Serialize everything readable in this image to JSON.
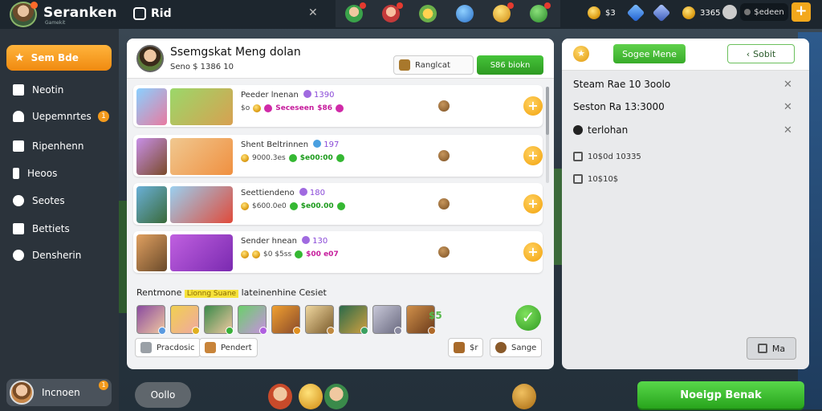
{
  "topbar": {
    "app_title": "Seranken",
    "app_subtitle": "Gamekit",
    "tab_label": "Rid",
    "res1_value": "$3",
    "res2_value": "3365",
    "pill_label": "$edeen",
    "plus_label": "+"
  },
  "sidebar": {
    "primary_label": "Sem Bde",
    "items": [
      {
        "label": "Neotin"
      },
      {
        "label": "Uepemnrtes",
        "badge": "1"
      },
      {
        "label": "Ripenhenn"
      },
      {
        "label": "Heoos"
      },
      {
        "label": "Seotes"
      },
      {
        "label": "Bettiets"
      },
      {
        "label": "Densherin"
      }
    ],
    "user_name": "Incnoen",
    "user_badge": "1"
  },
  "main": {
    "title": "Ssemgskat Meng dolan",
    "subtitle": "Seno $ 1386 10",
    "search_placeholder": "Ranglcat",
    "action_label": "S86 biokn",
    "rows": [
      {
        "title": "Peeder lnenan",
        "level": "1390",
        "meta": "$o",
        "score": "Seceseen",
        "score2": "$86"
      },
      {
        "title": "Shent Beltrinnen",
        "level": "197",
        "meta": "9000.3es",
        "score": "$e00:00"
      },
      {
        "title": "Seettiendeno",
        "level": "180",
        "meta": "$600.0e0",
        "score": "$e00.00"
      },
      {
        "title": "Sender hnean",
        "level": "130",
        "meta": "$0 $5ss",
        "score": "$00 e07"
      }
    ],
    "reward_label": "Rentmone",
    "reward_highlight": "Lionng Suane",
    "reward_tail": "lateinenhine Cesiet",
    "chars_more": "$5",
    "chips": [
      {
        "label": "Pracdosic"
      },
      {
        "label": "Pendert"
      },
      {
        "label": "$r"
      },
      {
        "label": "Sange"
      }
    ]
  },
  "right_panel": {
    "tab_active": "Sogee Mene",
    "tab_inactive": "Sobit",
    "items": [
      {
        "label": "Steam Rae 10 3oolo",
        "closable": true
      },
      {
        "label": "Seston Ra 13:3000",
        "closable": true
      },
      {
        "label": "terlohan",
        "closable": true
      },
      {
        "label": "10$0d 10335",
        "closable": false
      },
      {
        "label": "10$10$",
        "closable": false
      }
    ],
    "button_label": "Ma"
  },
  "bottom": {
    "pill_label": "Oollo",
    "cta_label": "Noeigp Benak"
  },
  "colors": {
    "accent_orange": "#f08a10",
    "accent_green": "#2d9a22",
    "sidebar_bg": "#2b333b",
    "topbar_bg": "#1d262e"
  }
}
